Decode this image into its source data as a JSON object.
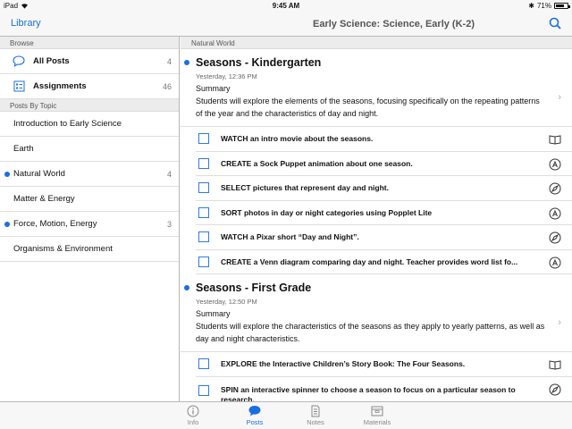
{
  "status": {
    "device": "iPad",
    "time": "9:45 AM",
    "battery": "71%",
    "battery_level": 0.71
  },
  "nav": {
    "back_label": "Library",
    "title": "Early Science: Science, Early (K-2)"
  },
  "sidebar": {
    "browse_header": "Browse",
    "browse_items": [
      {
        "label": "All Posts",
        "count": "4",
        "icon": "speech-bubble-icon"
      },
      {
        "label": "Assignments",
        "count": "46",
        "icon": "assignments-icon"
      }
    ],
    "topics_header": "Posts By Topic",
    "topics": [
      {
        "label": "Introduction to Early Science",
        "count": "",
        "unread": false
      },
      {
        "label": "Earth",
        "count": "",
        "unread": false
      },
      {
        "label": "Natural World",
        "count": "4",
        "unread": true
      },
      {
        "label": "Matter & Energy",
        "count": "",
        "unread": false
      },
      {
        "label": "Force, Motion, Energy",
        "count": "3",
        "unread": true
      },
      {
        "label": "Organisms & Environment",
        "count": "",
        "unread": false
      }
    ]
  },
  "main": {
    "section_header": "Natural World",
    "posts": [
      {
        "title": "Seasons - Kindergarten",
        "date": "Yesterday, 12:36 PM",
        "summary_label": "Summary",
        "summary": "Students will explore the elements of the seasons, focusing specifically on the repeating patterns of the year and the characteristics of day and night.",
        "tasks": [
          {
            "text": "WATCH an intro movie about the seasons.",
            "icon": "book-icon"
          },
          {
            "text": "CREATE a Sock Puppet animation about one season.",
            "icon": "app-store-icon"
          },
          {
            "text": "SELECT pictures that represent day and night.",
            "icon": "compass-icon"
          },
          {
            "text": "SORT photos in day or night categories using Popplet Lite",
            "icon": "app-store-icon"
          },
          {
            "text": "WATCH a Pixar short “Day and Night”.",
            "icon": "compass-icon"
          },
          {
            "text": "CREATE a Venn diagram comparing day and night. Teacher provides word list fo...",
            "icon": "app-store-icon"
          }
        ]
      },
      {
        "title": "Seasons - First Grade",
        "date": "Yesterday, 12:50 PM",
        "summary_label": "Summary",
        "summary": "Students will explore the characteristics of the seasons as they apply to yearly patterns, as well as day and night characteristics.",
        "tasks": [
          {
            "text": "EXPLORE the Interactive Children’s Story Book: The Four Seasons.",
            "icon": "book-icon"
          },
          {
            "text": "SPIN an interactive spinner to choose a season to focus on a particular season to research.",
            "icon": "compass-icon"
          }
        ]
      }
    ]
  },
  "tabs": [
    {
      "label": "Info",
      "icon": "info-icon",
      "active": false
    },
    {
      "label": "Posts",
      "icon": "speech-bubble-icon",
      "active": true
    },
    {
      "label": "Notes",
      "icon": "notes-icon",
      "active": false
    },
    {
      "label": "Materials",
      "icon": "materials-icon",
      "active": false
    }
  ],
  "colors": {
    "accent": "#1a6fe0",
    "unread_dot": "#1a6fe0"
  }
}
